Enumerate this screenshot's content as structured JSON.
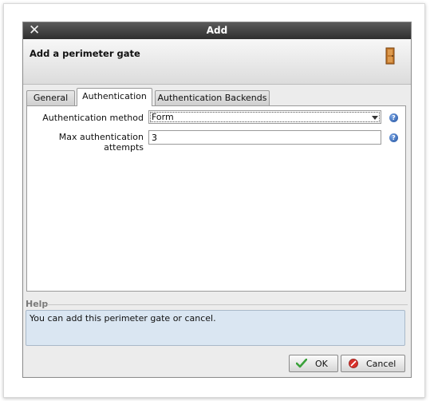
{
  "window": {
    "title": "Add"
  },
  "header": {
    "title": "Add a perimeter gate"
  },
  "tabs": [
    {
      "label": "General",
      "active": false
    },
    {
      "label": "Authentication",
      "active": true
    },
    {
      "label": "Authentication Backends",
      "active": false
    }
  ],
  "form": {
    "auth_method": {
      "label": "Authentication method",
      "value": "Form"
    },
    "max_attempts": {
      "label": "Max authentication attempts",
      "value": "3"
    }
  },
  "help": {
    "section_label": "Help",
    "text": "You can add this perimeter gate or cancel."
  },
  "buttons": {
    "ok_label": "OK",
    "cancel_label": "Cancel"
  },
  "icons": {
    "close": "close-icon",
    "gate": "door-icon",
    "help": "question-icon",
    "ok": "checkmark-icon",
    "cancel": "cancel-icon"
  },
  "colors": {
    "titlebar": "#3a3a3a",
    "help_box": "#dae6f2",
    "help_icon": "#1f4f9c"
  }
}
